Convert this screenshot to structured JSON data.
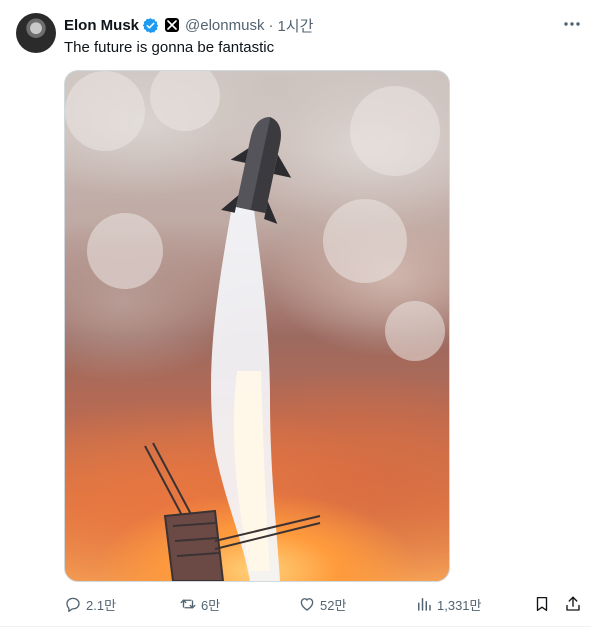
{
  "tweet": {
    "author_name": "Elon Musk",
    "handle": "@elonmusk",
    "separator": "·",
    "time": "1시간",
    "text": "The future is gonna be fantastic"
  },
  "actions": {
    "replies": "2.1만",
    "reposts": "6만",
    "likes": "52만",
    "views": "1,331만"
  },
  "colors": {
    "verified": "#1d9bf0",
    "muted_text": "#536471",
    "text": "#0f1419"
  },
  "icons": [
    "verified-badge-icon",
    "x-logo-icon",
    "more-icon",
    "reply-icon",
    "repost-icon",
    "like-icon",
    "views-icon",
    "bookmark-icon",
    "share-icon"
  ]
}
